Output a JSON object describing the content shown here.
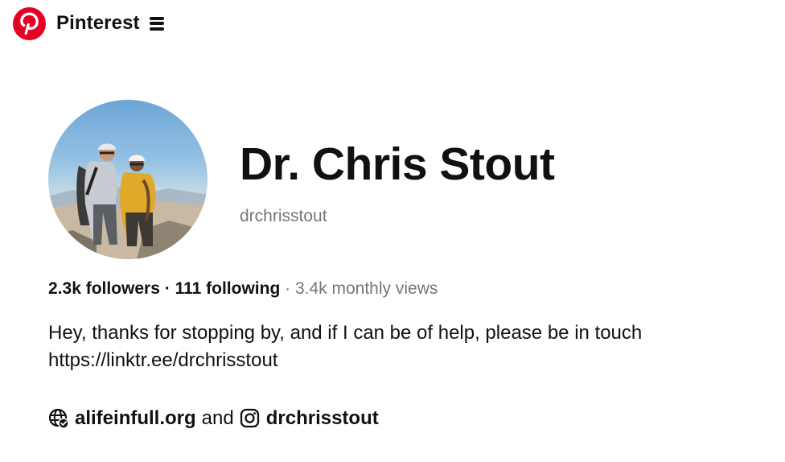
{
  "header": {
    "brand": "Pinterest",
    "brand_color": "#E60023",
    "logo_icon": "pinterest-logo",
    "menu_icon": "menu-icon"
  },
  "profile": {
    "name": "Dr. Chris Stout",
    "username": "drchrisstout",
    "followers": "2.3k followers",
    "separator_1": "·",
    "following": "111 following",
    "separator_2": "·",
    "monthly_views": "3.4k monthly views",
    "bio_lines": [
      "Hey, thanks for stopping by, and if I can be of help, please be in touch",
      "https://linktr.ee/drchrisstout"
    ]
  },
  "links": {
    "website": "alifeinfull.org",
    "website_icon": "verified-globe-icon",
    "connector": "and",
    "instagram": "drchrisstout",
    "instagram_icon": "instagram-icon"
  },
  "colors": {
    "text": "#111111",
    "muted": "#767676"
  }
}
